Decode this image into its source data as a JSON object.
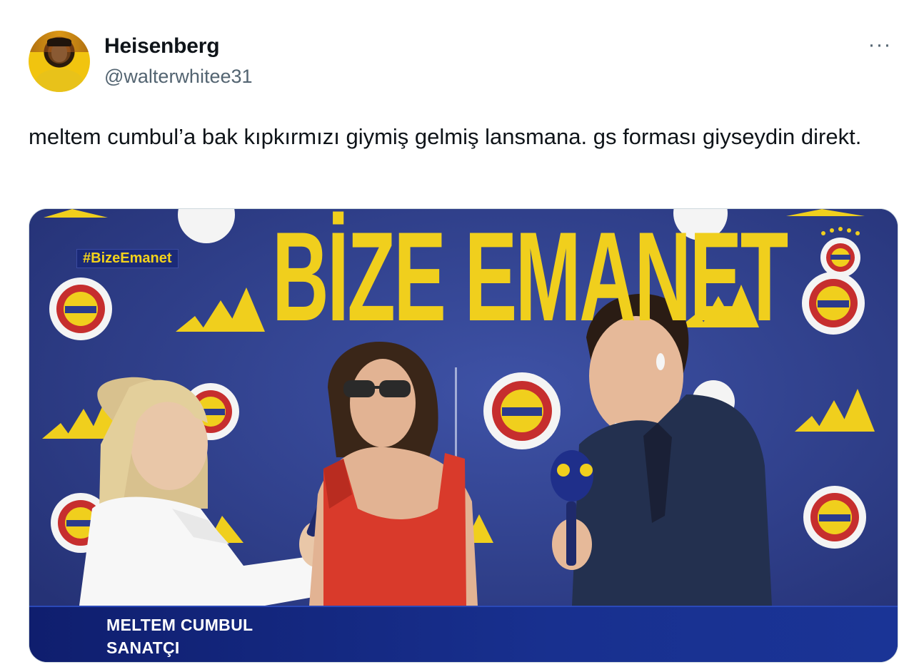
{
  "tweet": {
    "author": {
      "display_name": "Heisenberg",
      "handle": "@walterwhitee31",
      "avatar_icon": "profile-avatar"
    },
    "more_label": "···",
    "text": "meltem cumbul’a bak kıpkırmızı giymiş gelmiş lansmana. gs forması giyseydin direkt."
  },
  "media": {
    "headline": "BİZE EMANET",
    "hashtag": "#BizeEmanet",
    "lower_third": {
      "name": "MELTEM CUMBUL",
      "title": "SANATÇI"
    },
    "colors": {
      "backdrop": "#2f3e86",
      "accent_yellow": "#f0cf1d",
      "lower_third": "#18308f",
      "dress": "#d93a2b"
    }
  }
}
